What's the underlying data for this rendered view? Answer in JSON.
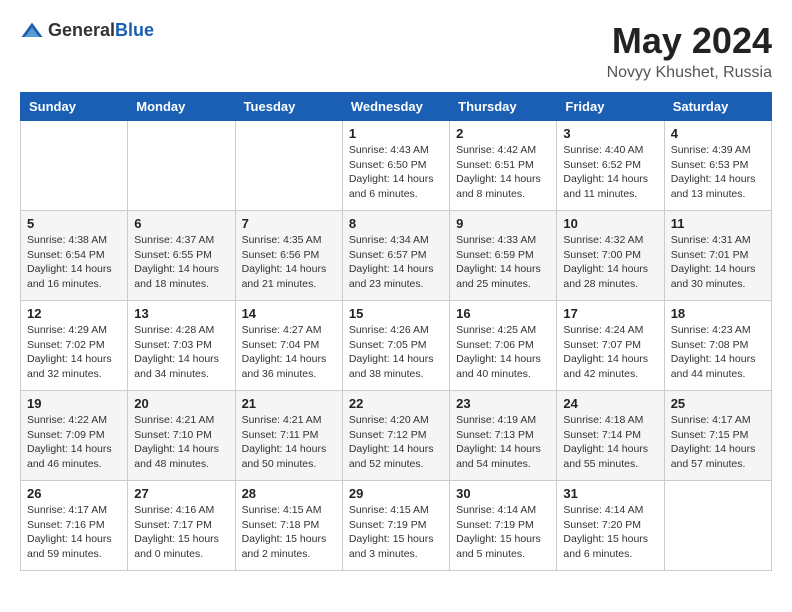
{
  "logo": {
    "text_general": "General",
    "text_blue": "Blue"
  },
  "title": {
    "month": "May 2024",
    "location": "Novyy Khushet, Russia"
  },
  "days_of_week": [
    "Sunday",
    "Monday",
    "Tuesday",
    "Wednesday",
    "Thursday",
    "Friday",
    "Saturday"
  ],
  "weeks": [
    [
      {
        "day": "",
        "info": ""
      },
      {
        "day": "",
        "info": ""
      },
      {
        "day": "",
        "info": ""
      },
      {
        "day": "1",
        "info": "Sunrise: 4:43 AM\nSunset: 6:50 PM\nDaylight: 14 hours\nand 6 minutes."
      },
      {
        "day": "2",
        "info": "Sunrise: 4:42 AM\nSunset: 6:51 PM\nDaylight: 14 hours\nand 8 minutes."
      },
      {
        "day": "3",
        "info": "Sunrise: 4:40 AM\nSunset: 6:52 PM\nDaylight: 14 hours\nand 11 minutes."
      },
      {
        "day": "4",
        "info": "Sunrise: 4:39 AM\nSunset: 6:53 PM\nDaylight: 14 hours\nand 13 minutes."
      }
    ],
    [
      {
        "day": "5",
        "info": "Sunrise: 4:38 AM\nSunset: 6:54 PM\nDaylight: 14 hours\nand 16 minutes."
      },
      {
        "day": "6",
        "info": "Sunrise: 4:37 AM\nSunset: 6:55 PM\nDaylight: 14 hours\nand 18 minutes."
      },
      {
        "day": "7",
        "info": "Sunrise: 4:35 AM\nSunset: 6:56 PM\nDaylight: 14 hours\nand 21 minutes."
      },
      {
        "day": "8",
        "info": "Sunrise: 4:34 AM\nSunset: 6:57 PM\nDaylight: 14 hours\nand 23 minutes."
      },
      {
        "day": "9",
        "info": "Sunrise: 4:33 AM\nSunset: 6:59 PM\nDaylight: 14 hours\nand 25 minutes."
      },
      {
        "day": "10",
        "info": "Sunrise: 4:32 AM\nSunset: 7:00 PM\nDaylight: 14 hours\nand 28 minutes."
      },
      {
        "day": "11",
        "info": "Sunrise: 4:31 AM\nSunset: 7:01 PM\nDaylight: 14 hours\nand 30 minutes."
      }
    ],
    [
      {
        "day": "12",
        "info": "Sunrise: 4:29 AM\nSunset: 7:02 PM\nDaylight: 14 hours\nand 32 minutes."
      },
      {
        "day": "13",
        "info": "Sunrise: 4:28 AM\nSunset: 7:03 PM\nDaylight: 14 hours\nand 34 minutes."
      },
      {
        "day": "14",
        "info": "Sunrise: 4:27 AM\nSunset: 7:04 PM\nDaylight: 14 hours\nand 36 minutes."
      },
      {
        "day": "15",
        "info": "Sunrise: 4:26 AM\nSunset: 7:05 PM\nDaylight: 14 hours\nand 38 minutes."
      },
      {
        "day": "16",
        "info": "Sunrise: 4:25 AM\nSunset: 7:06 PM\nDaylight: 14 hours\nand 40 minutes."
      },
      {
        "day": "17",
        "info": "Sunrise: 4:24 AM\nSunset: 7:07 PM\nDaylight: 14 hours\nand 42 minutes."
      },
      {
        "day": "18",
        "info": "Sunrise: 4:23 AM\nSunset: 7:08 PM\nDaylight: 14 hours\nand 44 minutes."
      }
    ],
    [
      {
        "day": "19",
        "info": "Sunrise: 4:22 AM\nSunset: 7:09 PM\nDaylight: 14 hours\nand 46 minutes."
      },
      {
        "day": "20",
        "info": "Sunrise: 4:21 AM\nSunset: 7:10 PM\nDaylight: 14 hours\nand 48 minutes."
      },
      {
        "day": "21",
        "info": "Sunrise: 4:21 AM\nSunset: 7:11 PM\nDaylight: 14 hours\nand 50 minutes."
      },
      {
        "day": "22",
        "info": "Sunrise: 4:20 AM\nSunset: 7:12 PM\nDaylight: 14 hours\nand 52 minutes."
      },
      {
        "day": "23",
        "info": "Sunrise: 4:19 AM\nSunset: 7:13 PM\nDaylight: 14 hours\nand 54 minutes."
      },
      {
        "day": "24",
        "info": "Sunrise: 4:18 AM\nSunset: 7:14 PM\nDaylight: 14 hours\nand 55 minutes."
      },
      {
        "day": "25",
        "info": "Sunrise: 4:17 AM\nSunset: 7:15 PM\nDaylight: 14 hours\nand 57 minutes."
      }
    ],
    [
      {
        "day": "26",
        "info": "Sunrise: 4:17 AM\nSunset: 7:16 PM\nDaylight: 14 hours\nand 59 minutes."
      },
      {
        "day": "27",
        "info": "Sunrise: 4:16 AM\nSunset: 7:17 PM\nDaylight: 15 hours\nand 0 minutes."
      },
      {
        "day": "28",
        "info": "Sunrise: 4:15 AM\nSunset: 7:18 PM\nDaylight: 15 hours\nand 2 minutes."
      },
      {
        "day": "29",
        "info": "Sunrise: 4:15 AM\nSunset: 7:19 PM\nDaylight: 15 hours\nand 3 minutes."
      },
      {
        "day": "30",
        "info": "Sunrise: 4:14 AM\nSunset: 7:19 PM\nDaylight: 15 hours\nand 5 minutes."
      },
      {
        "day": "31",
        "info": "Sunrise: 4:14 AM\nSunset: 7:20 PM\nDaylight: 15 hours\nand 6 minutes."
      },
      {
        "day": "",
        "info": ""
      }
    ]
  ]
}
